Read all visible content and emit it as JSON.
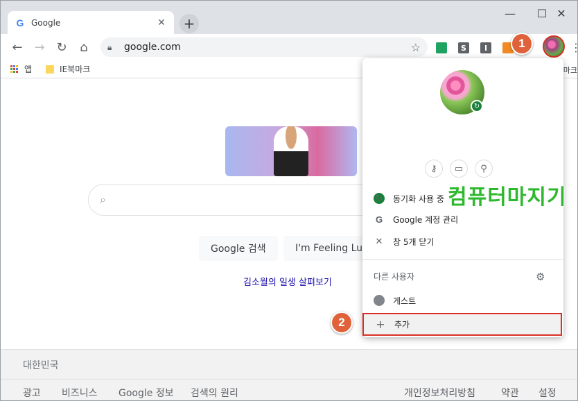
{
  "tab": {
    "title": "Google",
    "favicon": "G"
  },
  "toolbar": {
    "url": "google.com",
    "extensions": [
      {
        "label": "▪",
        "color": "#1ea362"
      },
      {
        "label": "S",
        "color": "#5f6368"
      },
      {
        "label": "I",
        "color": "#5f6368"
      },
      {
        "label": "",
        "color": "#f08a24"
      }
    ]
  },
  "bookmarks": {
    "apps": "앱",
    "folder": "IE북마크",
    "overflow": "마크"
  },
  "page": {
    "search_button": "Google 검색",
    "lucky_button": "I'm Feeling Lucky",
    "doodle_link": "김소월의 일생 살펴보기",
    "country": "대한민국",
    "footer_left": [
      "광고",
      "비즈니스",
      "Google 정보",
      "검색의 원리"
    ],
    "footer_right": [
      "개인정보처리방침",
      "약관",
      "설정"
    ]
  },
  "profile_menu": {
    "sync_status": "동기화 사용 중",
    "manage_account": "Google 계정 관리",
    "close_windows": "창 5개 닫기",
    "other_people": "다른 사용자",
    "guest": "게스트",
    "add": "추가"
  },
  "watermark": "컴퓨터마지기",
  "steps": [
    "1",
    "2"
  ],
  "colors": {
    "highlight": "#d93025",
    "step_badge": "#e0623a",
    "sync_green": "#188038",
    "link": "#1a0dab"
  }
}
